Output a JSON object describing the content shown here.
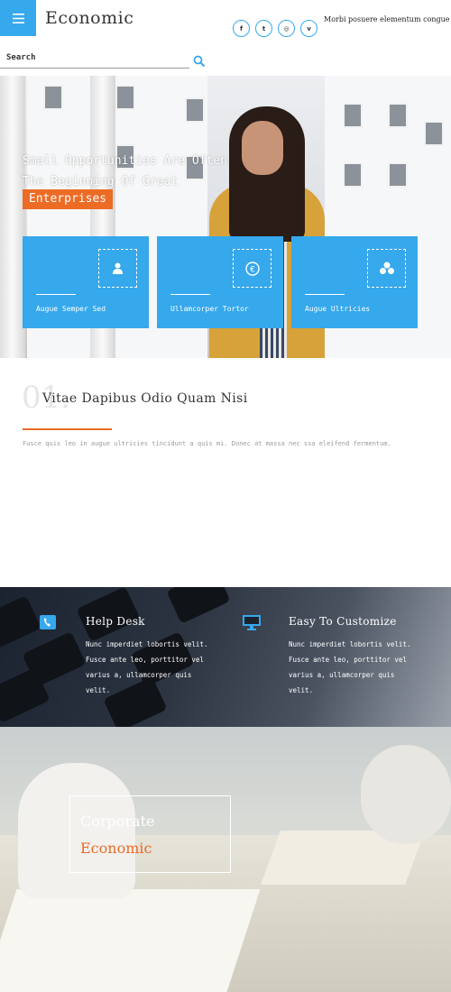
{
  "header": {
    "logo": "Economic",
    "tagline": "Morbi posuere elementum congue",
    "socials": [
      {
        "icon": "facebook-icon",
        "glyph": "f"
      },
      {
        "icon": "twitter-icon",
        "glyph": "t"
      },
      {
        "icon": "dribbble-icon",
        "glyph": "◎"
      },
      {
        "icon": "vimeo-icon",
        "glyph": "v"
      }
    ],
    "search_label": "Search"
  },
  "hero": {
    "line1": "Small Opportunities Are Often",
    "line2": "The Beginning Of Great",
    "accent": "Enterprises",
    "features": [
      {
        "label": "Augue Semper Sed",
        "icon": "user-icon"
      },
      {
        "label": "Ullamcorper Tortor",
        "icon": "euro-icon"
      },
      {
        "label": "Augue Ultricies",
        "icon": "coins-icon"
      }
    ]
  },
  "about": {
    "number": "01.",
    "title": "Vitae Dapibus Odio Quam Nisi",
    "text": "Fusce quis leo in augue ultricies tincidunt a quis mi. Donec at massa nec ssa eleifend fermentum."
  },
  "services": [
    {
      "title": "Help Desk",
      "icon": "phone-icon",
      "text": "Nunc imperdiet lobortis velit. Fusce ante leo, porttitor vel varius a, ullamcorper quis velit."
    },
    {
      "title": "Easy To Customize",
      "icon": "monitor-icon",
      "text": "Nunc imperdiet lobortis velit. Fusce ante leo, porttitor vel varius a, ullamcorper quis velit."
    }
  ],
  "corporate": {
    "line1": "Corporate",
    "line2": "Economic"
  },
  "colors": {
    "primary": "#36a8ec",
    "accent": "#ec6b25"
  }
}
